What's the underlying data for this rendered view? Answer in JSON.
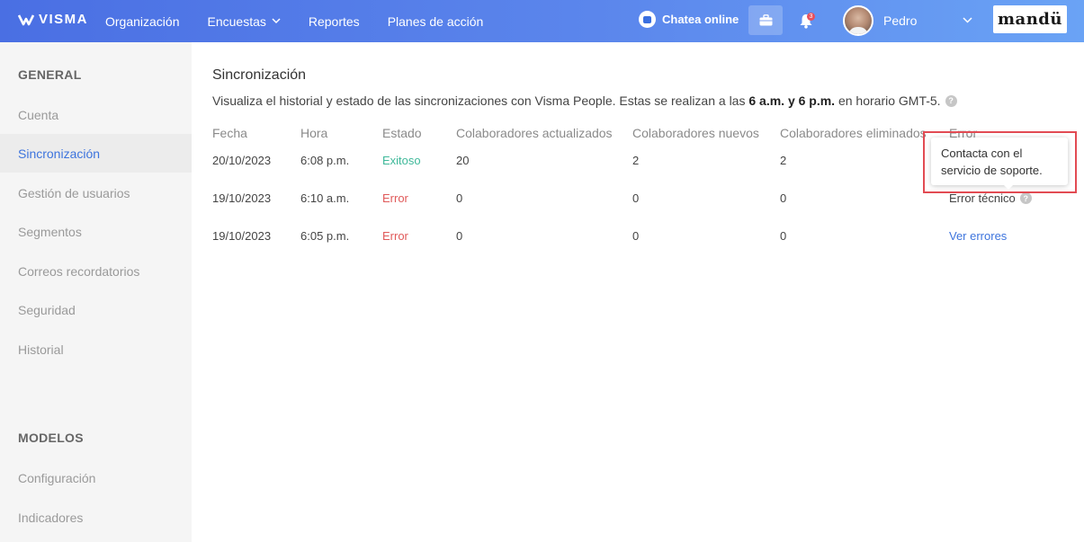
{
  "topbar": {
    "logo_text": "VISMA",
    "nav": [
      {
        "label": "Organización"
      },
      {
        "label": "Encuestas"
      },
      {
        "label": "Reportes"
      },
      {
        "label": "Planes de acción"
      }
    ],
    "chat_label": "Chatea online",
    "notifications_count": "3",
    "user_name": "Pedro",
    "brand": "mandü",
    "colors": {
      "gradient_start": "#4a6fe3",
      "gradient_end": "#6aa3f5"
    }
  },
  "sidebar": {
    "general_heading": "GENERAL",
    "general_items": [
      "Cuenta",
      "Sincronización",
      "Gestión de usuarios",
      "Segmentos",
      "Correos recordatorios",
      "Seguridad",
      "Historial"
    ],
    "active_item": "Sincronización",
    "models_heading": "MODELOS",
    "models_items": [
      "Configuración",
      "Indicadores"
    ]
  },
  "main": {
    "title": "Sincronización",
    "desc_prefix": "Visualiza el historial y estado de las sincronizaciones con Visma People. Estas se realizan a las",
    "desc_bold": "6 a.m. y 6 p.m.",
    "desc_suffix": "en horario GMT-5.",
    "help_glyph": "?",
    "table": {
      "headers": [
        "Fecha",
        "Hora",
        "Estado",
        "Colaboradores actualizados",
        "Colaboradores nuevos",
        "Colaboradores eliminados",
        "Error"
      ],
      "rows": [
        {
          "fecha": "20/10/2023",
          "hora": "6:08 p.m.",
          "estado": "Exitoso",
          "actualizados": "20",
          "nuevos": "2",
          "eliminados": "2",
          "error": ""
        },
        {
          "fecha": "19/10/2023",
          "hora": "6:10 a.m.",
          "estado": "Error",
          "actualizados": "0",
          "nuevos": "0",
          "eliminados": "0",
          "error": "Error técnico"
        },
        {
          "fecha": "19/10/2023",
          "hora": "6:05 p.m.",
          "estado": "Error",
          "actualizados": "0",
          "nuevos": "0",
          "eliminados": "0",
          "error": "Ver errores"
        }
      ]
    },
    "tooltip": "Contacta con el servicio de soporte.",
    "colors": {
      "success": "#3fb99a",
      "error": "#e05a5a",
      "link": "#3d74dd",
      "highlight": "#e24b53"
    }
  }
}
